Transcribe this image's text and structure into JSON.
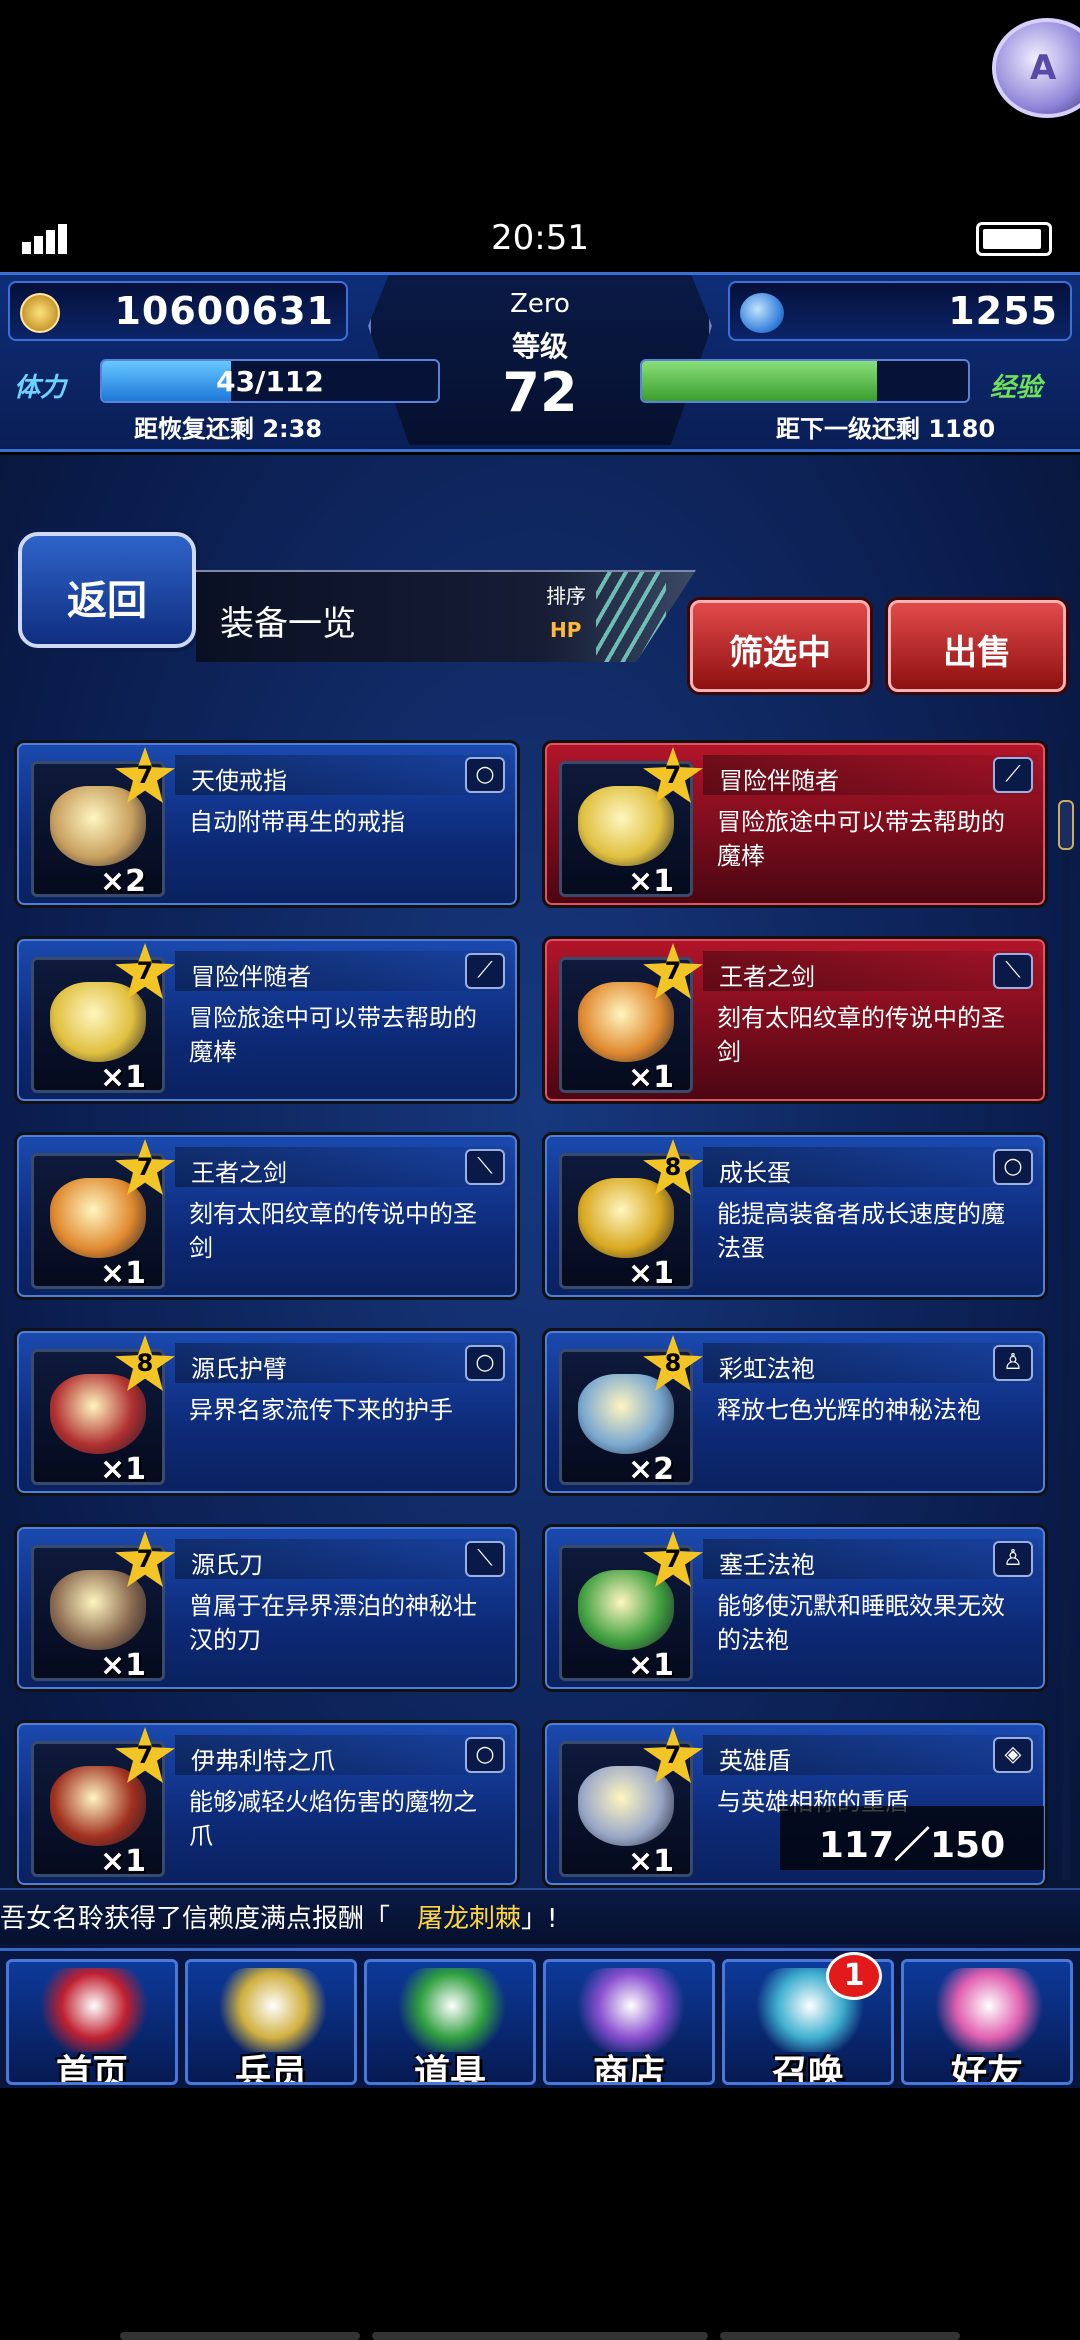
{
  "status_bar": {
    "time": "20:51"
  },
  "overlay": {
    "label": "A"
  },
  "header": {
    "gil": "10600631",
    "gems": "1255",
    "player_name": "Zero",
    "level_label": "等级",
    "level": "72",
    "stamina_label": "体力",
    "stamina_text": "43/112",
    "stamina_fraction": 0.384,
    "recover_text": "距恢复还剩 2:38",
    "exp_label": "经验",
    "exp_fraction": 0.72,
    "next_level_text": "距下一级还剩 1180"
  },
  "toolbar": {
    "back_label": "返回",
    "title": "装备一览",
    "sort_label": "排序",
    "sort_value": "HP",
    "filter_label": "筛选中",
    "sell_label": "出售"
  },
  "items": [
    {
      "name": "天使戒指",
      "desc": "自动附带再生的戒指",
      "rarity": "7",
      "qty": "×2",
      "type": "ring",
      "highlight": false,
      "color": "#c8a060"
    },
    {
      "name": "冒险伴随者",
      "desc": "冒险旅途中可以带去帮助的魔棒",
      "rarity": "7",
      "qty": "×1",
      "type": "staff",
      "highlight": true,
      "color": "#e0c040"
    },
    {
      "name": "冒险伴随者",
      "desc": "冒险旅途中可以带去帮助的魔棒",
      "rarity": "7",
      "qty": "×1",
      "type": "staff",
      "highlight": false,
      "color": "#e0c040"
    },
    {
      "name": "王者之剑",
      "desc": "刻有太阳纹章的传说中的圣剑",
      "rarity": "7",
      "qty": "×1",
      "type": "sword",
      "highlight": true,
      "color": "#e08a30"
    },
    {
      "name": "王者之剑",
      "desc": "刻有太阳纹章的传说中的圣剑",
      "rarity": "7",
      "qty": "×1",
      "type": "sword",
      "highlight": false,
      "color": "#e08a30"
    },
    {
      "name": "成长蛋",
      "desc": "能提高装备者成长速度的魔法蛋",
      "rarity": "8",
      "qty": "×1",
      "type": "ring",
      "highlight": false,
      "color": "#d8a820"
    },
    {
      "name": "源氏护臂",
      "desc": "异界名家流传下来的护手",
      "rarity": "8",
      "qty": "×1",
      "type": "ring",
      "highlight": false,
      "color": "#b03030"
    },
    {
      "name": "彩虹法袍",
      "desc": "释放七色光辉的神秘法袍",
      "rarity": "8",
      "qty": "×2",
      "type": "robe",
      "highlight": false,
      "color": "#7aa8d0"
    },
    {
      "name": "源氏刀",
      "desc": "曾属于在异界漂泊的神秘壮汉的刀",
      "rarity": "7",
      "qty": "×1",
      "type": "sword",
      "highlight": false,
      "color": "#8a6a50"
    },
    {
      "name": "塞壬法袍",
      "desc": "能够使沉默和睡眠效果无效的法袍",
      "rarity": "7",
      "qty": "×1",
      "type": "robe",
      "highlight": false,
      "color": "#40a040"
    },
    {
      "name": "伊弗利特之爪",
      "desc": "能够减轻火焰伤害的魔物之爪",
      "rarity": "7",
      "qty": "×1",
      "type": "ring",
      "highlight": false,
      "color": "#a03020"
    },
    {
      "name": "英雄盾",
      "desc": "与英雄相称的重盾",
      "rarity": "7",
      "qty": "×1",
      "type": "shield",
      "highlight": false,
      "color": "#9aa8c8"
    }
  ],
  "type_icons": {
    "ring": "○",
    "staff": "⟋",
    "sword": "⟍",
    "robe": "♙",
    "shield": "◈"
  },
  "counter": "117／150",
  "ticker": {
    "prefix": "吾女名聆获得了信赖度满点报酬「",
    "highlight": "屠龙刺棘",
    "suffix": "」!"
  },
  "nav": [
    {
      "label": "首页",
      "color": "#c02030"
    },
    {
      "label": "兵员",
      "color": "#d0b040"
    },
    {
      "label": "道具",
      "color": "#30a040"
    },
    {
      "label": "商店",
      "color": "#8a50d0"
    },
    {
      "label": "召唤",
      "color": "#40b0d0"
    },
    {
      "label": "好友",
      "color": "#e060b0"
    }
  ],
  "summon_badge": "1"
}
